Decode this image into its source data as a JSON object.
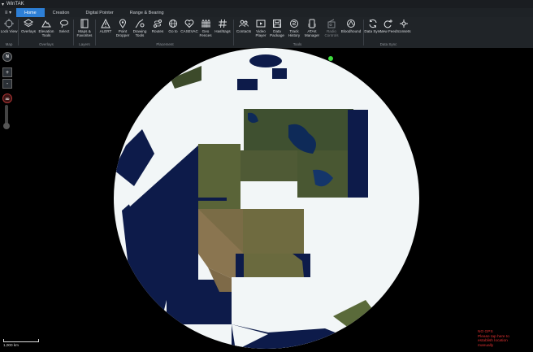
{
  "window": {
    "title": "WinTAK"
  },
  "tabs": [
    {
      "label": "Home",
      "active": true
    },
    {
      "label": "Creation",
      "active": false
    },
    {
      "label": "Digital Pointer",
      "active": false
    },
    {
      "label": "Range & Bearing",
      "active": false
    }
  ],
  "ribbon": {
    "map": {
      "lock_view": "Lock View",
      "group": "Map"
    },
    "overlays": {
      "overlays": "Overlays",
      "elevation_tools": "Elevation Tools",
      "select": "Select",
      "group": "Overlays"
    },
    "layers": {
      "maps_favorites": "Maps & Favorites",
      "group": "Layers"
    },
    "placement": {
      "alert": "ALERT",
      "point_dropper": "Point Dropper",
      "drawing_tools": "Drawing Tools",
      "routes": "Routes",
      "go_to": "Go to",
      "casevac": "CASEVAC",
      "geo_fences": "Geo Fences",
      "hashtags": "Hashtags",
      "group": "Placement"
    },
    "tools": {
      "contacts": "Contacts",
      "video_player": "Video Player",
      "data_package": "Data Package",
      "track_history": "Track History",
      "atak_manager": "ATAK Manager",
      "radio_controls": "Radio Controls",
      "bloodhound": "Bloodhound",
      "group": "Tools"
    },
    "data_sync": {
      "data_sync": "Data Sync",
      "new_feed": "New Feed",
      "iconsets": "Iconsets",
      "group": "Data Sync"
    }
  },
  "map": {
    "compass": "N",
    "zoom_in": "+",
    "zoom_out": "-",
    "dimension_badge": "3D",
    "scale": "1,000 km",
    "status_lines": [
      "NO GPS",
      "Please tap here to",
      "establish location",
      "manually"
    ]
  },
  "colors": {
    "accent": "#2d7fd6",
    "status": "#e03030",
    "globe_fill": "#f2f6f7",
    "ocean": "#0d1b4a"
  }
}
